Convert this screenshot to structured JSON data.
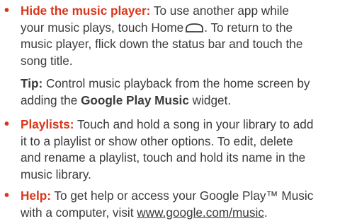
{
  "items": [
    {
      "term": "Hide the music player:",
      "line1_rest": " To use another app while",
      "line2_before_icon": "your music plays, touch Home",
      "line2_after_icon": ". To return to the",
      "line3": "music player, flick down the status bar and touch the",
      "line4": "song title.",
      "icon": "home-icon"
    },
    {
      "term": "Playlists:",
      "line1_rest": " Touch and hold a song in your library to add",
      "line2": "it to a playlist or show other options. To edit, delete",
      "line3": "and rename a playlist, touch and hold its name in the",
      "line4": "music library."
    },
    {
      "term": "Help:",
      "line1_rest": " To get help or access your Google Play™ Music",
      "line2_before_link": "with a computer, visit ",
      "link": "www.google.com/music",
      "line2_after_link": "."
    }
  ],
  "tip": {
    "label": "Tip:",
    "line1_rest": " Control music playback from the home screen by",
    "line2_before": "adding the ",
    "widget": "Google Play Music",
    "line2_after": " widget."
  },
  "bullet_symbol": "•",
  "colors": {
    "accent": "#d9361b",
    "text": "#3a3a3a"
  }
}
